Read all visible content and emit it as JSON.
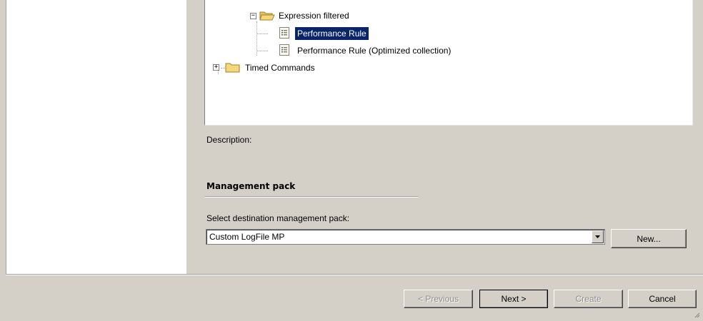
{
  "tree": {
    "items": [
      {
        "label": "Expression filtered",
        "icon": "open-folder-icon",
        "expanded": true
      },
      {
        "label": "Performance Rule",
        "icon": "rule-icon",
        "selected": true
      },
      {
        "label": "Performance Rule (Optimized collection)",
        "icon": "rule-icon",
        "selected": false
      },
      {
        "label": "Timed Commands",
        "icon": "folder-icon",
        "expanded": false
      }
    ]
  },
  "description": {
    "label": "Description:"
  },
  "management_pack": {
    "heading": "Management pack",
    "select_label": "Select destination management pack:",
    "selected_value": "Custom LogFile MP",
    "new_label": "New..."
  },
  "footer": {
    "previous_label": "< Previous",
    "next_label": "Next >",
    "create_label": "Create",
    "cancel_label": "Cancel"
  },
  "colors": {
    "selection": "#0a246a",
    "dialog_bg": "#d4d0c8",
    "folder": "#f5d67a"
  }
}
